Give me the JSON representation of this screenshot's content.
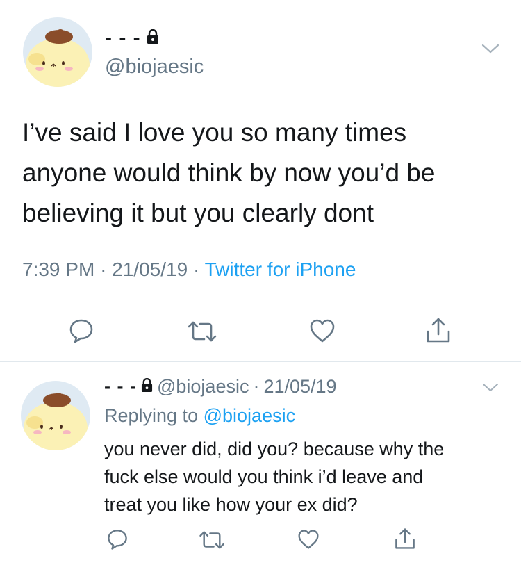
{
  "main_tweet": {
    "display_name": "- - -",
    "handle": "@biojaesic",
    "text_lines": [
      "I’ve said I love you so many times",
      "anyone would think by now you’d be",
      "believing it but you clearly dont"
    ],
    "time": "7:39 PM",
    "date": "21/05/19",
    "separator": "·",
    "source": "Twitter for iPhone"
  },
  "reply_tweet": {
    "display_name": "- - -",
    "handle": "@biojaesic",
    "separator": "·",
    "date": "21/05/19",
    "replying_prefix": "Replying to",
    "replying_handle": "@biojaesic",
    "text_lines": [
      "you never did, did you? because why the",
      "fuck else would you think i’d leave and",
      "treat you like how your ex did?"
    ]
  },
  "icons": {
    "lock": "lock-icon",
    "caret": "chevron-down-icon",
    "reply": "reply-icon",
    "retweet": "retweet-icon",
    "like": "heart-icon",
    "share": "share-icon"
  },
  "colors": {
    "text": "#14171a",
    "secondary": "#657786",
    "accent": "#1da1f2",
    "divider": "#e1e8ed"
  }
}
